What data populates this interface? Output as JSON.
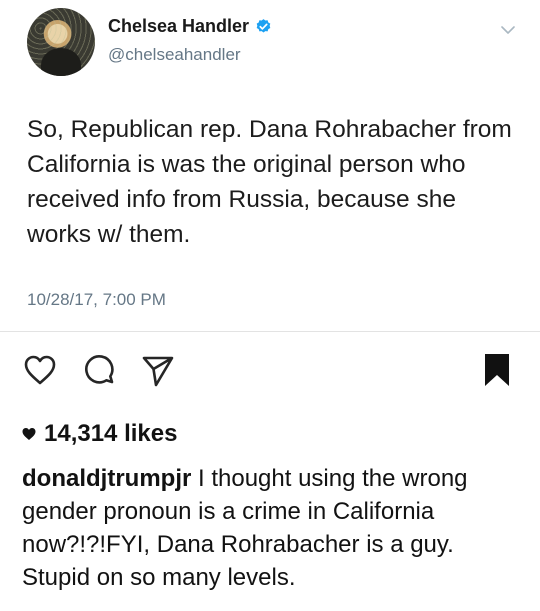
{
  "tweet": {
    "display_name": "Chelsea Handler",
    "handle": "@chelseahandler",
    "text": "So, Republican rep. Dana Rohrabacher from California is was the original person who received info from Russia, because she works w/ them.",
    "timestamp": "10/28/17, 7:00 PM",
    "verified_color": "#1da1f2",
    "icons": {
      "verified": "verified-badge-icon",
      "menu": "chevron-down-icon"
    }
  },
  "post": {
    "icons": {
      "like": "heart-icon",
      "comment": "comment-bubble-icon",
      "share": "paper-plane-icon",
      "save": "bookmark-icon"
    },
    "likes": "14,314 likes",
    "comment": {
      "user": "donaldjtrumpjr",
      "text": "I thought using the wrong gender pronoun is a crime in California now?!?!FYI, Dana Rohrabacher is a guy. Stupid on so many levels."
    }
  }
}
